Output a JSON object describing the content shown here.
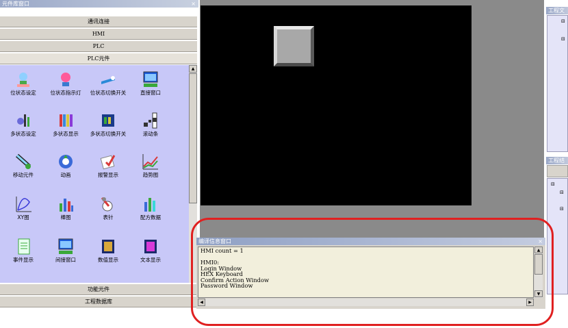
{
  "left_panel": {
    "title": "元件库窗口",
    "categories": [
      "通讯连接",
      "HMI",
      "PLC",
      "PLC元件"
    ],
    "items": [
      {
        "label": "位状态设定",
        "icon": "bulb-icon"
      },
      {
        "label": "位状态指示灯",
        "icon": "lamp-icon"
      },
      {
        "label": "位状态切换开关",
        "icon": "switch-icon"
      },
      {
        "label": "直接窗口",
        "icon": "window-icon"
      },
      {
        "label": "多状态设定",
        "icon": "multi-state-icon"
      },
      {
        "label": "多状态显示",
        "icon": "bars-icon"
      },
      {
        "label": "多状态切换开关",
        "icon": "multi-switch-icon"
      },
      {
        "label": "滚动条",
        "icon": "scrollbar-icon"
      },
      {
        "label": "移动元件",
        "icon": "move-icon"
      },
      {
        "label": "动画",
        "icon": "animation-icon"
      },
      {
        "label": "报警显示",
        "icon": "alarm-icon"
      },
      {
        "label": "趋势图",
        "icon": "trend-icon"
      },
      {
        "label": "XY图",
        "icon": "xy-chart-icon"
      },
      {
        "label": "棒图",
        "icon": "bar-chart-icon"
      },
      {
        "label": "表针",
        "icon": "meter-icon"
      },
      {
        "label": "配方数据",
        "icon": "recipe-icon"
      },
      {
        "label": "事件显示",
        "icon": "event-icon"
      },
      {
        "label": "间接窗口",
        "icon": "indirect-window-icon"
      },
      {
        "label": "数值显示",
        "icon": "number-icon"
      },
      {
        "label": "文本显示",
        "icon": "text-icon"
      }
    ],
    "bottom_categories": [
      "功能元件",
      "工程数据库"
    ]
  },
  "compile_window": {
    "title": "编译信息窗口",
    "lines": [
      "HMI count = 1",
      "",
      "HMI0:",
      "Login Window",
      "HEX Keyboard",
      "Confirm Action Window",
      "Password Window"
    ]
  },
  "right_panels": {
    "top_title": "工程文",
    "mid_title": "工程结"
  },
  "colors": {
    "annotation": "#e02020",
    "palette_bg": "#c8c8f8",
    "canvas": "#000000"
  }
}
